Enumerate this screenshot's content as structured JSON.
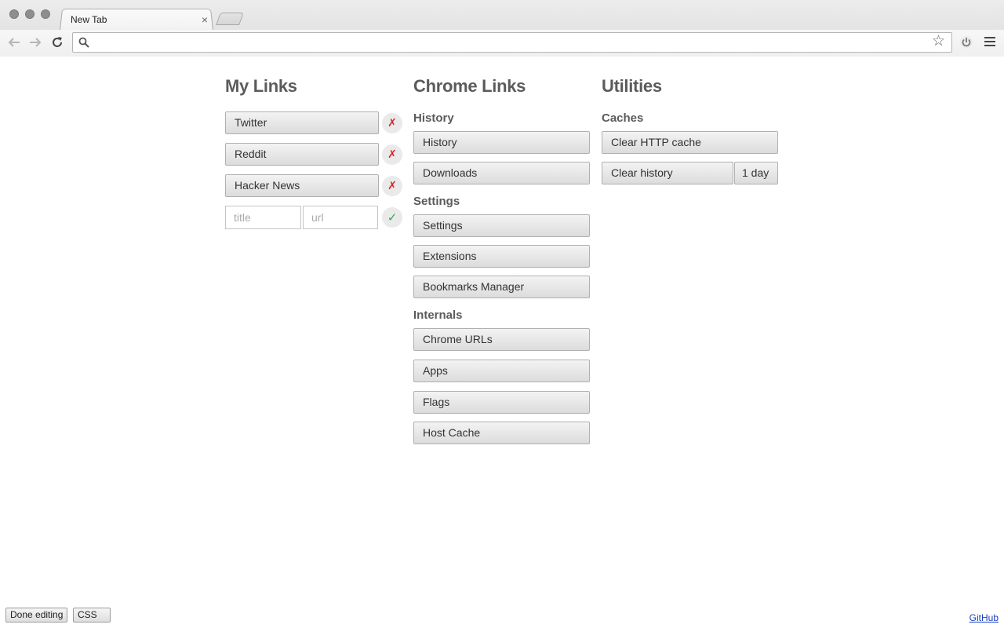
{
  "browser": {
    "tab_title": "New Tab",
    "tab_close": "×",
    "omnibox_value": ""
  },
  "my_links": {
    "heading": "My Links",
    "links": [
      {
        "label": "Twitter",
        "remove": "✗"
      },
      {
        "label": "Reddit",
        "remove": "✗"
      },
      {
        "label": "Hacker News",
        "remove": "✗"
      }
    ],
    "new_link": {
      "title_placeholder": "title",
      "url_placeholder": "url",
      "confirm": "✓"
    }
  },
  "chrome_links": {
    "heading": "Chrome Links",
    "groups": [
      {
        "title": "History",
        "items": [
          "History",
          "Downloads"
        ]
      },
      {
        "title": "Settings",
        "items": [
          "Settings",
          "Extensions",
          "Bookmarks Manager"
        ]
      },
      {
        "title": "Internals",
        "items": [
          "Chrome URLs",
          "Apps",
          "Flags",
          "Host Cache"
        ]
      }
    ]
  },
  "utilities": {
    "heading": "Utilities",
    "caches_title": "Caches",
    "clear_http_cache": "Clear HTTP cache",
    "clear_history": "Clear history",
    "history_range": "1 day"
  },
  "footer": {
    "done_editing": "Done editing",
    "css": "CSS",
    "github": "GitHub"
  }
}
